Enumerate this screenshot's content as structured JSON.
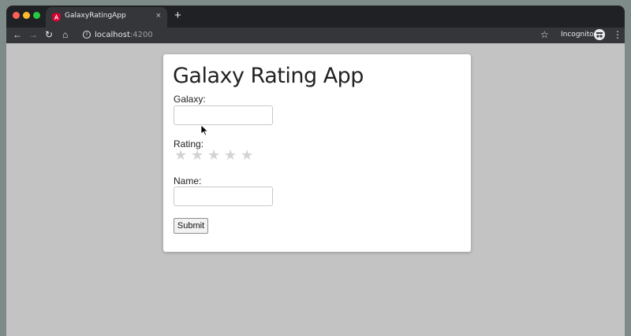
{
  "browser": {
    "tab_title": "GalaxyRatingApp",
    "tab_close": "×",
    "new_tab": "+",
    "url_host": "localhost",
    "url_port": ":4200",
    "incognito_label": "Incognito",
    "icons": {
      "back": "←",
      "forward": "→",
      "reload": "↻",
      "home": "⌂",
      "info": "i",
      "star": "☆",
      "menu": "⋮"
    }
  },
  "form": {
    "title": "Galaxy Rating App",
    "galaxy_label": "Galaxy:",
    "galaxy_value": "",
    "rating_label": "Rating:",
    "rating_value": 0,
    "rating_max": 5,
    "star_glyph": "★",
    "name_label": "Name:",
    "name_value": "",
    "submit_label": "Submit"
  },
  "colors": {
    "star_inactive": "#d3d3d3",
    "page_background": "#c4c3c4",
    "angular_red": "#dd0031"
  }
}
